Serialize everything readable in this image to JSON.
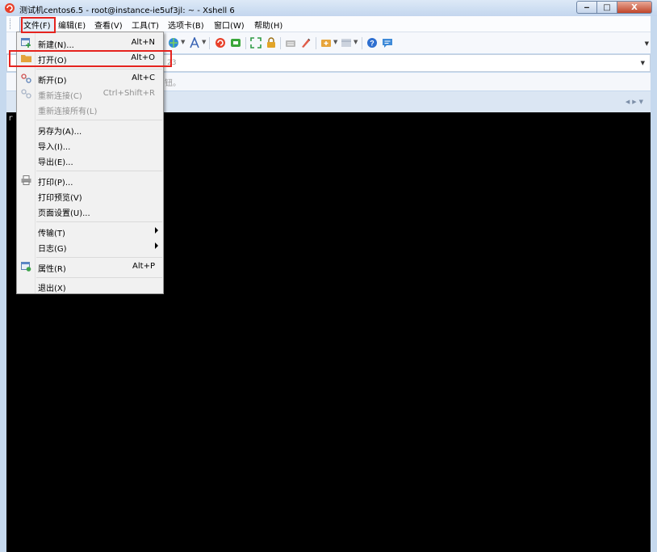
{
  "window": {
    "title": "测试机centos6.5 - root@instance-ie5uf3jl: ~ - Xshell 6",
    "minimize": "‒",
    "maximize": "□",
    "close": "X"
  },
  "menubar": {
    "items": [
      {
        "label": "文件(F)"
      },
      {
        "label": "编辑(E)"
      },
      {
        "label": "查看(V)"
      },
      {
        "label": "工具(T)"
      },
      {
        "label": "选项卡(B)"
      },
      {
        "label": "窗口(W)"
      },
      {
        "label": "帮助(H)"
      }
    ]
  },
  "address": {
    "partial_text": "23"
  },
  "hint": {
    "partial_text": "钮。"
  },
  "terminal": {
    "partial_text": "r"
  },
  "file_menu": {
    "items": [
      {
        "label": "新建(N)...",
        "shortcut": "Alt+N"
      },
      {
        "label": "打开(O)",
        "shortcut": "Alt+O"
      },
      {
        "label": "断开(D)",
        "shortcut": "Alt+C"
      },
      {
        "label": "重新连接(C)",
        "shortcut": "Ctrl+Shift+R"
      },
      {
        "label": "重新连接所有(L)",
        "shortcut": ""
      },
      {
        "label": "另存为(A)...",
        "shortcut": ""
      },
      {
        "label": "导入(I)...",
        "shortcut": ""
      },
      {
        "label": "导出(E)...",
        "shortcut": ""
      },
      {
        "label": "打印(P)...",
        "shortcut": ""
      },
      {
        "label": "打印预览(V)",
        "shortcut": ""
      },
      {
        "label": "页面设置(U)...",
        "shortcut": ""
      },
      {
        "label": "传输(T)",
        "shortcut": ""
      },
      {
        "label": "日志(G)",
        "shortcut": ""
      },
      {
        "label": "属性(R)",
        "shortcut": "Alt+P"
      },
      {
        "label": "退出(X)",
        "shortcut": ""
      }
    ]
  },
  "colors": {
    "highlight": "#e5231e",
    "terminal_bg": "#000000",
    "accent": "#c6d9ee"
  }
}
